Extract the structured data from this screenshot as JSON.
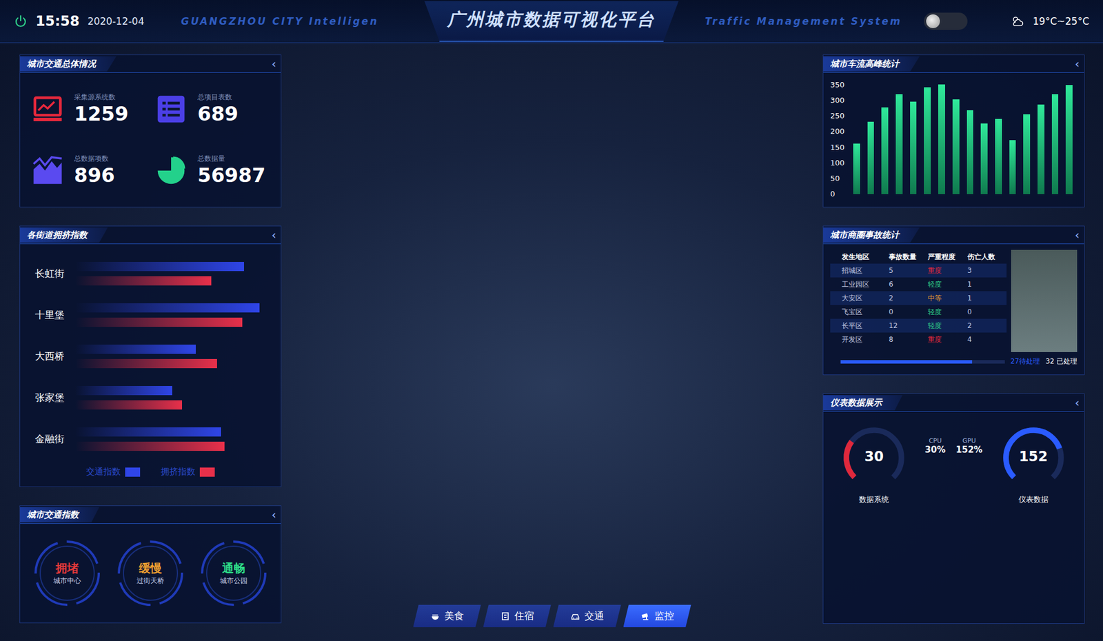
{
  "header": {
    "time": "15:58",
    "date": "2020-12-04",
    "subtitle_left": "GUANGZHOU CITY Intelligen",
    "title": "广州城市数据可视化平台",
    "subtitle_right": "Traffic Management System",
    "weather": "19°C~25°C",
    "night_mode": true
  },
  "overview": {
    "title": "城市交通总体情况",
    "collapse": "‹",
    "stats": [
      {
        "label": "采集源系统数",
        "value": "1259",
        "kind": "monitor",
        "color": "#e8283c"
      },
      {
        "label": "总项目表数",
        "value": "689",
        "kind": "list",
        "color": "#4b3fe6"
      },
      {
        "label": "总数据项数",
        "value": "896",
        "kind": "chart",
        "color": "#5a4af0"
      },
      {
        "label": "总数据量",
        "value": "56987",
        "kind": "pie",
        "color": "#23d18b"
      }
    ]
  },
  "congestion": {
    "title": "各街道拥挤指数",
    "collapse": "‹",
    "streets": [
      {
        "name": "长虹街",
        "traffic": 0.87,
        "congestion": 0.7
      },
      {
        "name": "十里堡",
        "traffic": 0.95,
        "congestion": 0.86
      },
      {
        "name": "大西桥",
        "traffic": 0.62,
        "congestion": 0.73
      },
      {
        "name": "张家堡",
        "traffic": 0.5,
        "congestion": 0.55
      },
      {
        "name": "金融街",
        "traffic": 0.75,
        "congestion": 0.77
      }
    ],
    "legend": [
      {
        "label": "交通指数",
        "color": "#2f45e8"
      },
      {
        "label": "拥挤指数",
        "color": "#e8304a"
      }
    ]
  },
  "traffic_index": {
    "title": "城市交通指数",
    "collapse": "‹",
    "items": [
      {
        "status": "拥堵",
        "place": "城市中心",
        "color": "#e83a3a"
      },
      {
        "status": "缓慢",
        "place": "过街天桥",
        "color": "#f0a030"
      },
      {
        "status": "通畅",
        "place": "城市公园",
        "color": "#2fe08a"
      }
    ]
  },
  "nav": [
    {
      "label": "美食",
      "kind": "food",
      "selected": false
    },
    {
      "label": "住宿",
      "kind": "hotel",
      "selected": false
    },
    {
      "label": "交通",
      "kind": "car",
      "selected": false
    },
    {
      "label": "监控",
      "kind": "camera",
      "selected": true
    }
  ],
  "peak_chart": {
    "title": "城市车流高峰统计",
    "collapse": "‹",
    "ticks": [
      "350",
      "300",
      "250",
      "200",
      "150",
      "100",
      "50",
      "0"
    ],
    "max": 350,
    "values": [
      162,
      231,
      277,
      318,
      295,
      341,
      350,
      302,
      268,
      226,
      240,
      172,
      254,
      286,
      318,
      348
    ]
  },
  "accidents": {
    "title": "城市商圈事故统计",
    "collapse": "‹",
    "columns": [
      "发生地区",
      "事故数量",
      "严重程度",
      "伤亡人数"
    ],
    "rows": [
      {
        "area": "招城区",
        "count": "5",
        "severity": "重度",
        "color": "#e8283c",
        "casualties": "3"
      },
      {
        "area": "工业园区",
        "count": "6",
        "severity": "轻度",
        "color": "#2fd08a",
        "casualties": "1"
      },
      {
        "area": "大安区",
        "count": "2",
        "severity": "中等",
        "color": "#f0a030",
        "casualties": "1"
      },
      {
        "area": "飞宝区",
        "count": "0",
        "severity": "轻度",
        "color": "#2fd08a",
        "casualties": "0"
      },
      {
        "area": "长平区",
        "count": "12",
        "severity": "轻度",
        "color": "#2fd08a",
        "casualties": "2"
      },
      {
        "area": "开发区",
        "count": "8",
        "severity": "重度",
        "color": "#e8283c",
        "casualties": "4"
      }
    ],
    "progress": {
      "level": 0.8,
      "pending": "27待处理",
      "done": "32 已处理"
    }
  },
  "gauges": {
    "title": "仪表数据展示",
    "collapse": "‹",
    "dials": [
      {
        "value": "30",
        "level": 0.3,
        "color": "#e0283c",
        "label": "数据系统"
      },
      {
        "value": "152",
        "level": 0.76,
        "color": "#2a5bff",
        "label": "仪表数据"
      }
    ],
    "stats": [
      {
        "label": "CPU",
        "value": "30%"
      },
      {
        "label": "GPU",
        "value": "152%"
      }
    ]
  }
}
